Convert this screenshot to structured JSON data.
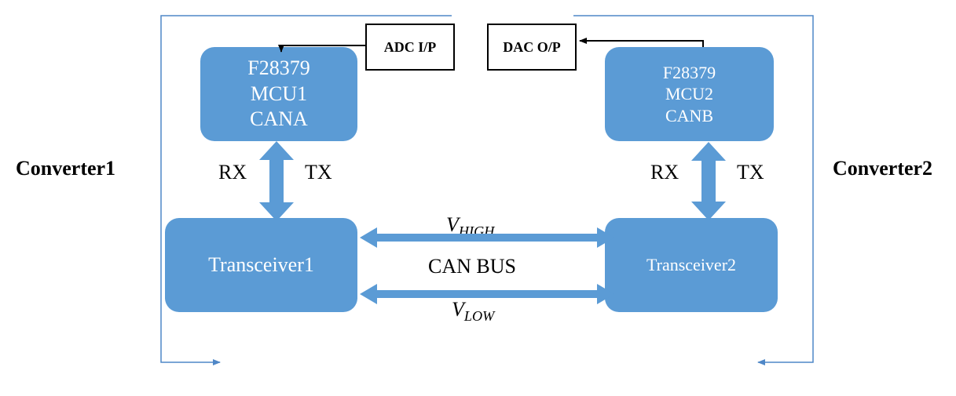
{
  "title_left": "Converter1",
  "title_right": "Converter2",
  "mcu1": {
    "line1": "F28379",
    "line2": "MCU1",
    "line3": "CANA"
  },
  "mcu2": {
    "line1": "F28379",
    "line2": "MCU2",
    "line3": "CANB"
  },
  "adc_box": "ADC I/P",
  "dac_box": "DAC O/P",
  "rx1": "RX",
  "tx1": "TX",
  "rx2": "RX",
  "tx2": "TX",
  "transceiver1": "Transceiver1",
  "transceiver2": "Transceiver2",
  "vhigh_prefix": "V",
  "vhigh_sub": "HIGH",
  "canbus": "CAN BUS",
  "vlow_prefix": "V",
  "vlow_sub": "LOW",
  "colors": {
    "block": "#5b9bd5",
    "bracket": "#4f87c7"
  },
  "chart_data": {
    "type": "diagram",
    "nodes": [
      {
        "id": "mcu1",
        "label": "F28379 MCU1 CANA"
      },
      {
        "id": "mcu2",
        "label": "F28379 MCU2 CANB"
      },
      {
        "id": "adc",
        "label": "ADC I/P"
      },
      {
        "id": "dac",
        "label": "DAC O/P"
      },
      {
        "id": "trx1",
        "label": "Transceiver1"
      },
      {
        "id": "trx2",
        "label": "Transceiver2"
      }
    ],
    "edges": [
      {
        "from": "adc",
        "to": "mcu1",
        "dir": "in"
      },
      {
        "from": "mcu2",
        "to": "dac",
        "dir": "out"
      },
      {
        "from": "mcu1",
        "to": "trx1",
        "labels": [
          "RX",
          "TX"
        ],
        "bidir": true
      },
      {
        "from": "mcu2",
        "to": "trx2",
        "labels": [
          "RX",
          "TX"
        ],
        "bidir": true
      },
      {
        "from": "trx1",
        "to": "trx2",
        "labels": [
          "V_HIGH",
          "CAN BUS",
          "V_LOW"
        ],
        "bidir": true
      }
    ],
    "groups": [
      {
        "name": "Converter1",
        "members": [
          "mcu1",
          "trx1",
          "adc"
        ]
      },
      {
        "name": "Converter2",
        "members": [
          "mcu2",
          "trx2",
          "dac"
        ]
      }
    ]
  }
}
